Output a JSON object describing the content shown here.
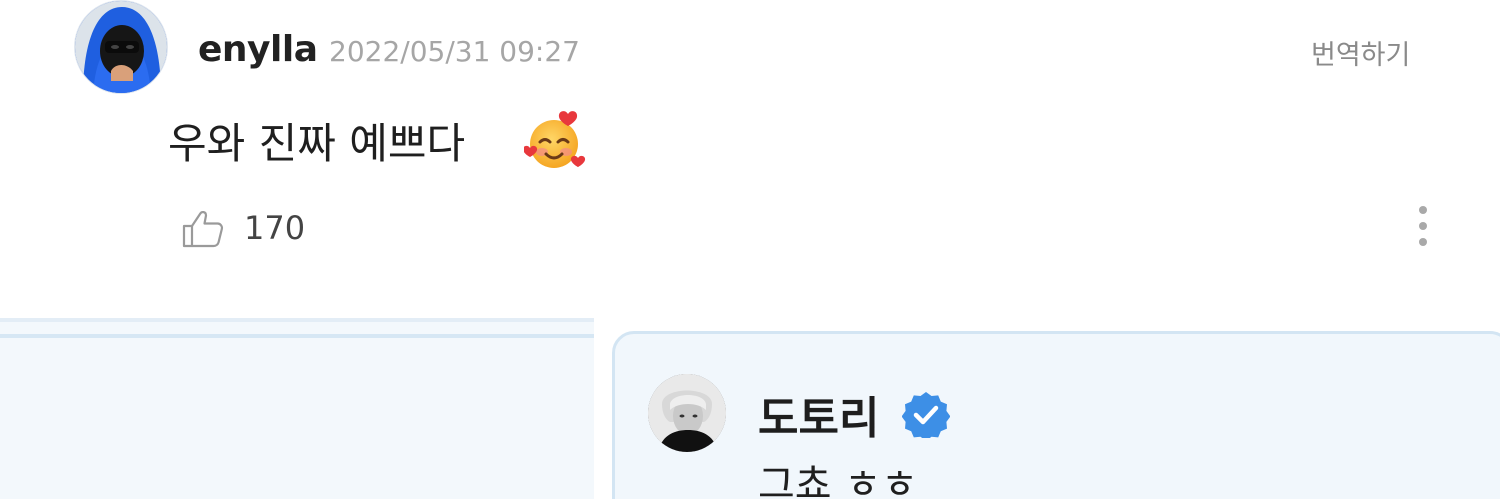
{
  "comment": {
    "username": "enylla",
    "timestamp": "2022/05/31 09:27",
    "translate_label": "번역하기",
    "text": "우와 진짜 예쁘다",
    "emoji": "smiling-face-with-hearts-icon",
    "likes": "170"
  },
  "reply": {
    "username": "도토리",
    "verified": true,
    "text": "그쵸 ㅎㅎ"
  },
  "colors": {
    "accent_blue": "#3d8fe6",
    "reply_background": "#f1f7fc",
    "reply_border": "#d3e5f3",
    "timestamp_gray": "#a6a6a6"
  }
}
